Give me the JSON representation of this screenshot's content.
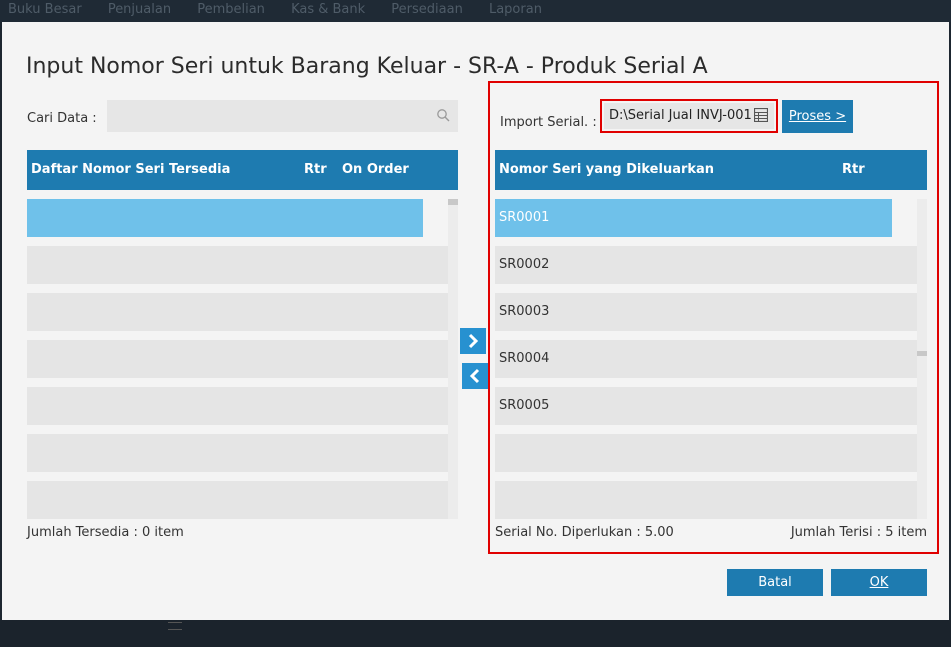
{
  "menubar": [
    "Buku Besar",
    "Penjualan",
    "Pembelian",
    "Kas & Bank",
    "Persediaan",
    "Laporan"
  ],
  "title": "Input Nomor Seri untuk Barang Keluar - SR-A - Produk Serial A",
  "search": {
    "label": "Cari Data :",
    "value": ""
  },
  "left_table": {
    "headers": {
      "serial": "Daftar Nomor Seri Tersedia",
      "rtr": "Rtr",
      "on_order": "On Order"
    },
    "rows": [
      "",
      "",
      "",
      "",
      "",
      "",
      ""
    ],
    "footer": "Jumlah Tersedia : 0 item"
  },
  "import": {
    "label": "Import Serial. :",
    "value": "D:\\Serial Jual INVJ-001",
    "proses_label": "Proses >"
  },
  "right_table": {
    "headers": {
      "serial": "Nomor Seri yang Dikeluarkan",
      "rtr": "Rtr"
    },
    "rows": [
      "SR0001",
      "SR0002",
      "SR0003",
      "SR0004",
      "SR0005",
      "",
      ""
    ],
    "footer_left": "Serial No. Diperlukan : 5.00",
    "footer_right": "Jumlah Terisi : 5 item"
  },
  "buttons": {
    "batal": "Batal",
    "ok": "OK"
  },
  "icons": {
    "move_right": "chevron-right-icon",
    "move_left": "chevron-left-icon",
    "search": "search-icon",
    "browse": "table-icon"
  },
  "colors": {
    "header": "#1e7bb0",
    "selected_row": "#6fc1ea",
    "highlight": "#e00000"
  }
}
